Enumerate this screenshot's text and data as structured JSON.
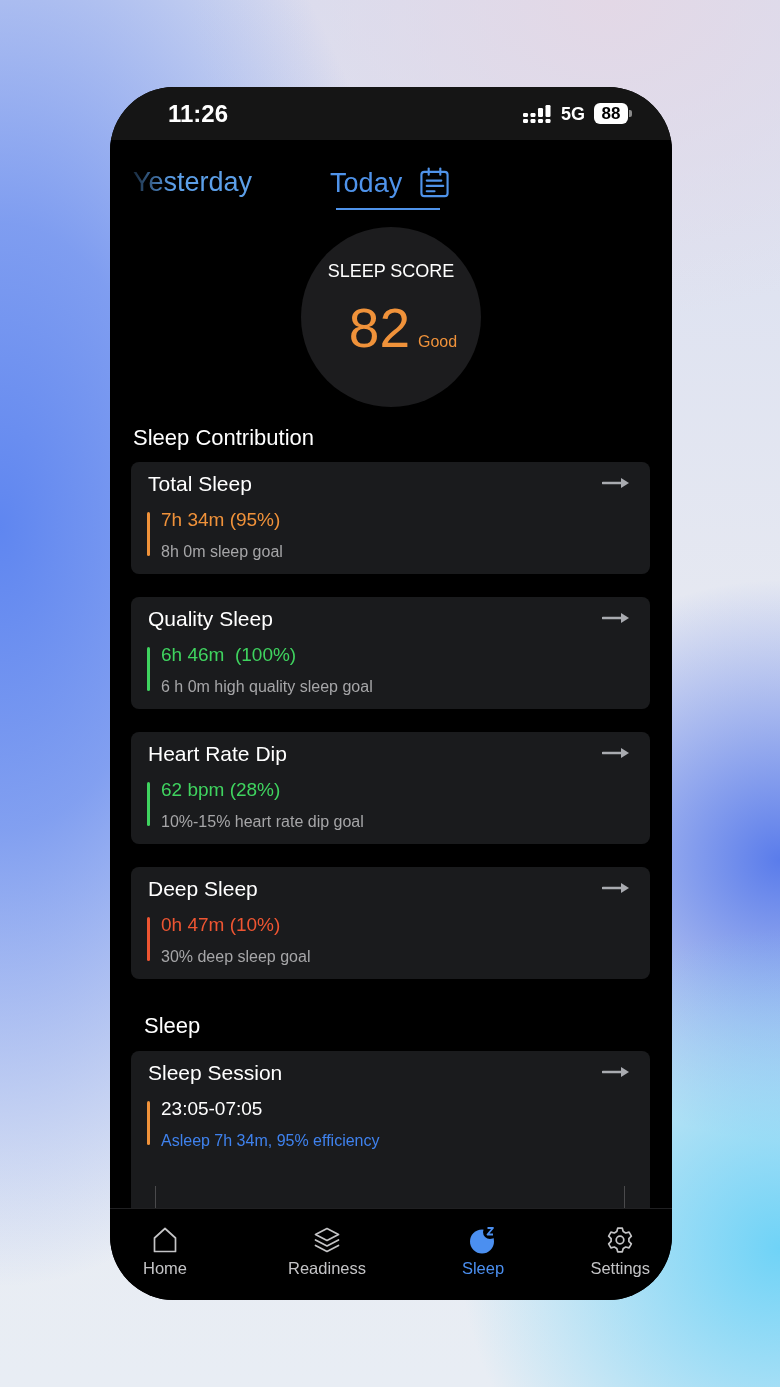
{
  "status_bar": {
    "time": "11:26",
    "network": "5G",
    "battery": "88"
  },
  "date_tabs": [
    {
      "label": "Yesterday",
      "selected": false
    },
    {
      "label": "Today",
      "selected": true
    }
  ],
  "sleep_score": {
    "title": "SLEEP SCORE",
    "value": "82",
    "rating": "Good"
  },
  "sleep_contribution": {
    "title": "Sleep Contribution",
    "cards": [
      {
        "title": "Total Sleep",
        "value": "7h 34m (95%)",
        "goal": "8h 0m sleep goal",
        "color": "#f0923a"
      },
      {
        "title": "Quality Sleep",
        "value": "6h 46m  (100%)",
        "goal": "6 h 0m high quality sleep goal",
        "color": "#3fd35f"
      },
      {
        "title": "Heart Rate Dip",
        "value": "62 bpm (28%)",
        "goal": "10%-15% heart rate dip goal",
        "color": "#3fd35f"
      },
      {
        "title": "Deep Sleep",
        "value": "0h 47m (10%)",
        "goal": "30% deep sleep goal",
        "color": "#ee5532"
      }
    ]
  },
  "sleep": {
    "title": "Sleep",
    "session": {
      "title": "Sleep Session",
      "time_range": "23:05-07:05",
      "summary": "Asleep 7h 34m, 95% efficiency"
    }
  },
  "bottom_nav": [
    {
      "label": "Home",
      "selected": false
    },
    {
      "label": "Readiness",
      "selected": false
    },
    {
      "label": "Sleep",
      "selected": true
    },
    {
      "label": "Settings",
      "selected": false
    }
  ]
}
